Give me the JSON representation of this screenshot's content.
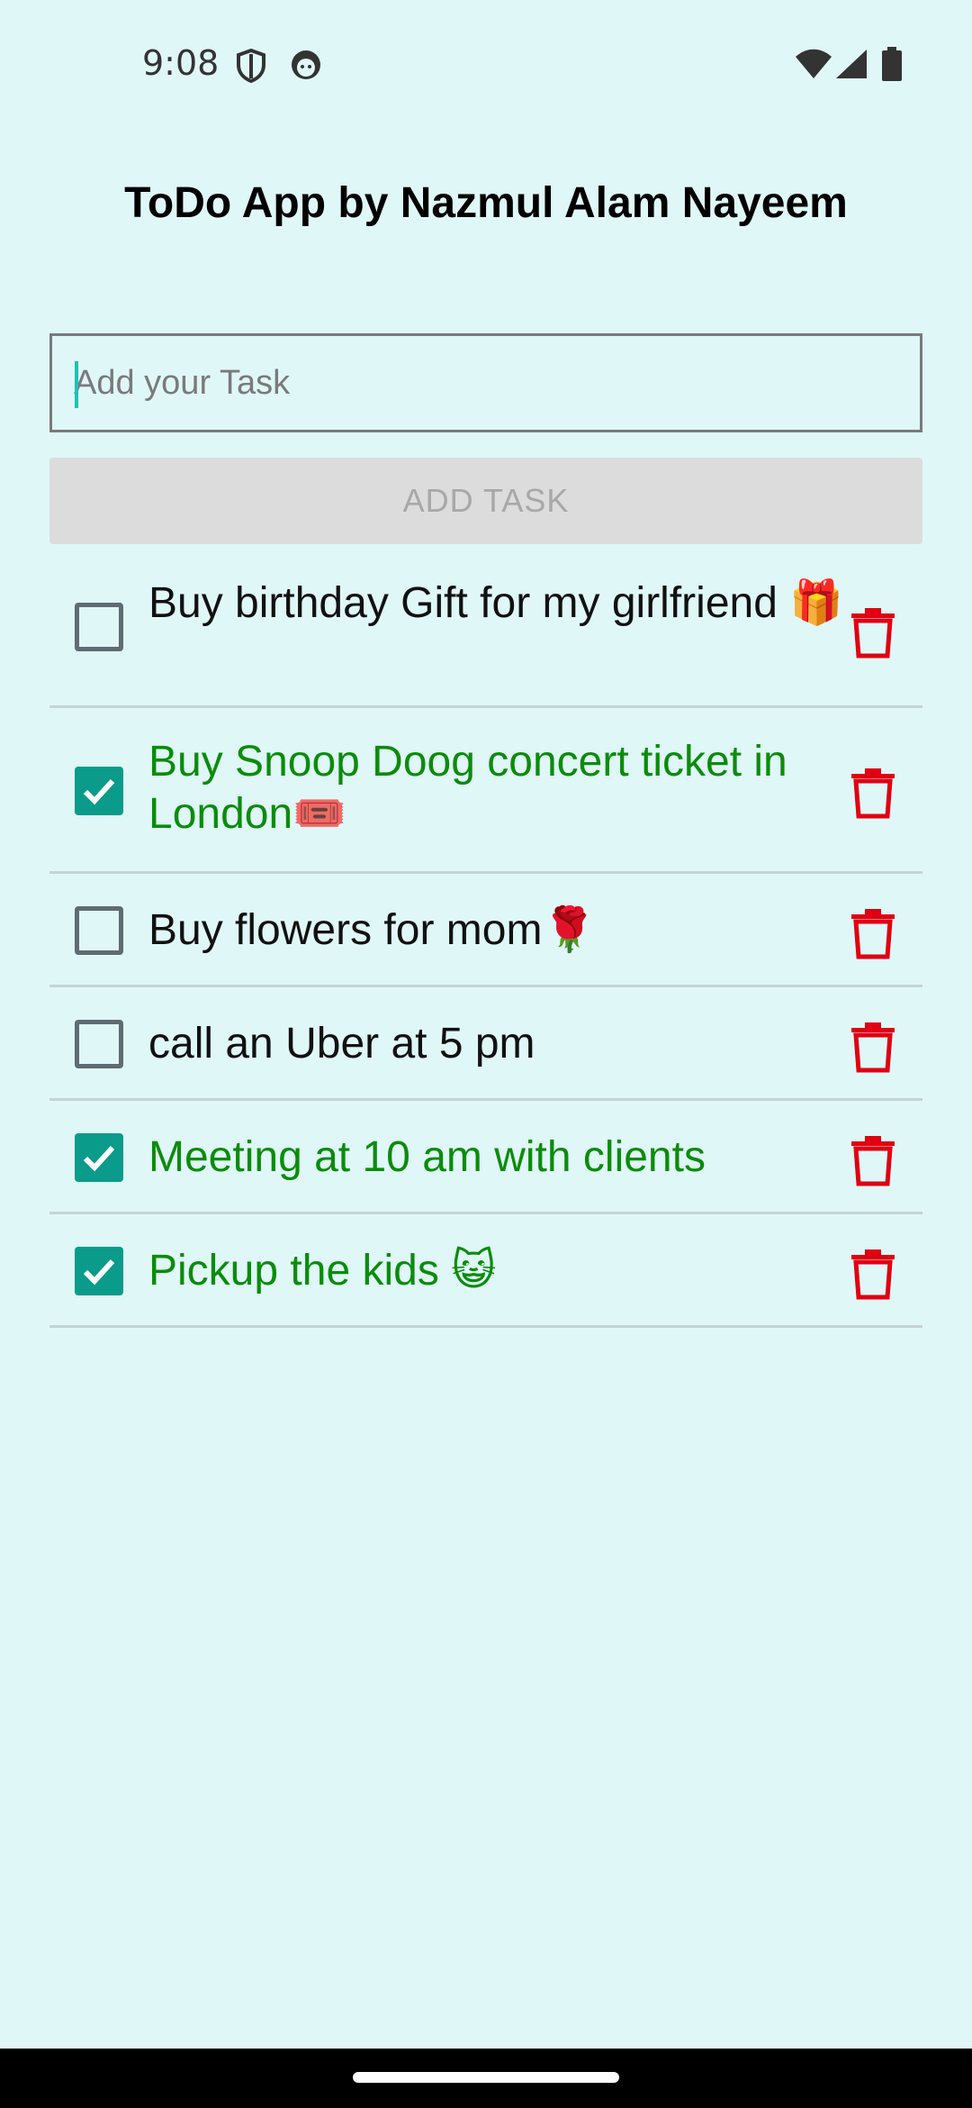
{
  "status_bar": {
    "time": "9:08",
    "left_icons": [
      "shield-icon",
      "face-icon"
    ],
    "right_icons": [
      "wifi-icon",
      "signal-icon",
      "battery-icon"
    ]
  },
  "app": {
    "title": "ToDo App by Nazmul Alam Nayeem"
  },
  "input": {
    "placeholder": "Add your Task",
    "value": ""
  },
  "add_button": {
    "label": "ADD TASK",
    "enabled": false
  },
  "tasks": [
    {
      "text": "Buy birthday Gift for my girlfriend 🎁",
      "done": false
    },
    {
      "text": "Buy Snoop Doog concert ticket in London🎟️",
      "done": true
    },
    {
      "text": "Buy flowers for mom🌹",
      "done": false
    },
    {
      "text": "call an Uber at 5 pm",
      "done": false
    },
    {
      "text": "Meeting at 10 am with clients",
      "done": true
    },
    {
      "text": "Pickup the kids 😺",
      "done": true
    }
  ],
  "colors": {
    "background": "#e0f7f8",
    "checkbox_checked": "#0a9b8a",
    "done_text": "#0b8c0b",
    "delete_icon": "#e00012",
    "cursor": "#1bc2b5"
  }
}
